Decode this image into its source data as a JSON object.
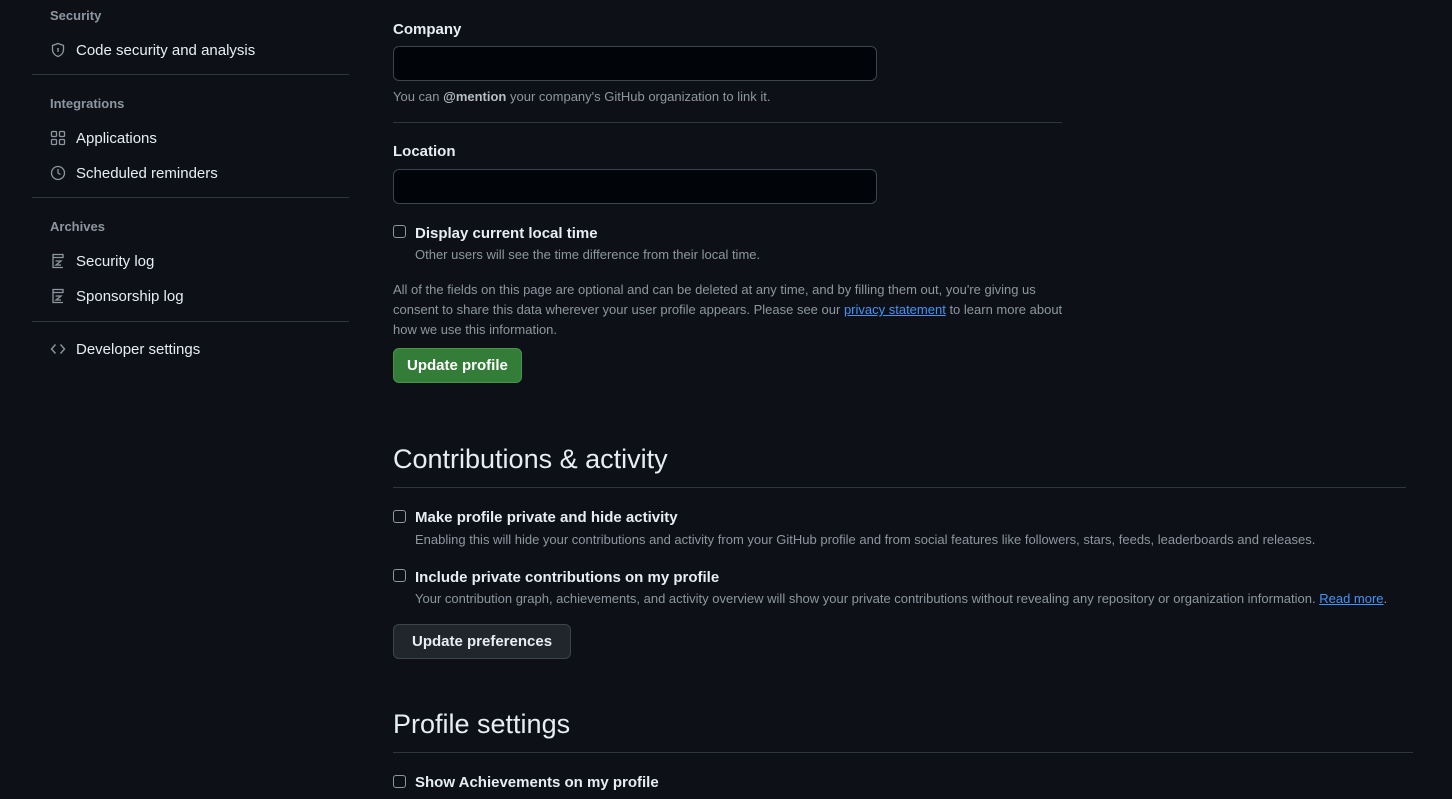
{
  "sidebar": {
    "groups": [
      {
        "title": "Security",
        "items": [
          {
            "label": "Code security and analysis",
            "icon": "shield-icon"
          }
        ]
      },
      {
        "title": "Integrations",
        "items": [
          {
            "label": "Applications",
            "icon": "apps-grid-icon"
          },
          {
            "label": "Scheduled reminders",
            "icon": "clock-icon"
          }
        ]
      },
      {
        "title": "Archives",
        "items": [
          {
            "label": "Security log",
            "icon": "log-icon"
          },
          {
            "label": "Sponsorship log",
            "icon": "log-icon"
          }
        ]
      }
    ],
    "developer": {
      "label": "Developer settings",
      "icon": "code-icon"
    }
  },
  "profile": {
    "company": {
      "label": "Company",
      "value": "",
      "note_prefix": "You can",
      "note_bold": "@mention",
      "note_suffix": "your company's GitHub organization to link it."
    },
    "location": {
      "label": "Location",
      "value": ""
    },
    "local_time": {
      "label": "Display current local time",
      "description": "Other users will see the time difference from their local time.",
      "checked": false
    },
    "disclaimer": {
      "prefix": "All of the fields on this page are optional and can be deleted at any time, and by filling them out, you're giving us consent to share this data wherever your user profile appears. Please see our",
      "link": "privacy statement",
      "suffix": "to learn more about how we use this information."
    },
    "update_button": "Update profile"
  },
  "contributions": {
    "title": "Contributions & activity",
    "private_profile": {
      "label": "Make profile private and hide activity",
      "description": "Enabling this will hide your contributions and activity from your GitHub profile and from social features like followers, stars, feeds, leaderboards and releases.",
      "checked": false
    },
    "private_contributions": {
      "label": "Include private contributions on my profile",
      "description": "Your contribution graph, achievements, and activity overview will show your private contributions without revealing any repository or organization information.",
      "link": "Read more",
      "link_suffix": ".",
      "checked": false
    },
    "update_button": "Update preferences"
  },
  "profile_settings": {
    "title": "Profile settings",
    "achievements": {
      "label": "Show Achievements on my profile",
      "checked": false
    }
  },
  "colors": {
    "background": "#0d1117",
    "primary_button": "#347d39",
    "link": "#4493f8",
    "muted_text": "#8d96a0",
    "border": "#30363d"
  }
}
